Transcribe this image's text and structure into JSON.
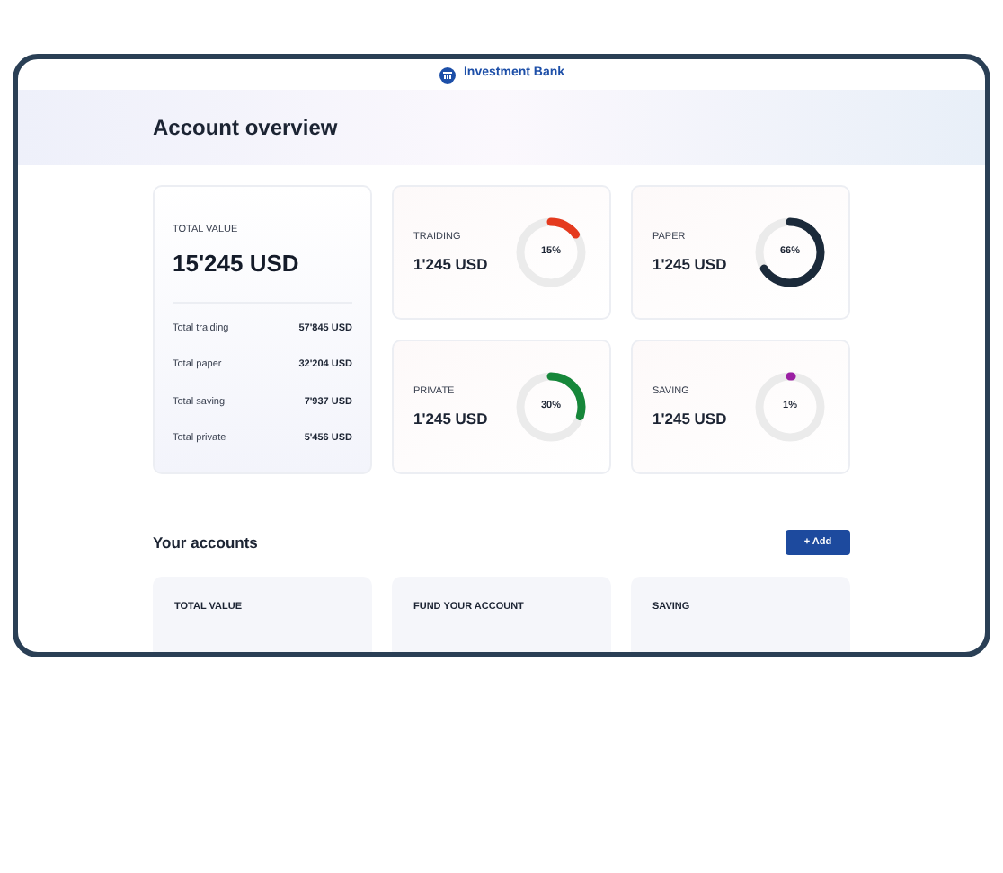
{
  "header": {
    "brand": "Investment Bank"
  },
  "page": {
    "title": "Account overview"
  },
  "summary": {
    "label": "TOTAL VALUE",
    "value": "15'245 USD",
    "rows": [
      {
        "label": "Total traiding",
        "value": "57'845 USD"
      },
      {
        "label": "Total paper",
        "value": "32'204 USD"
      },
      {
        "label": "Total saving",
        "value": "7'937 USD"
      },
      {
        "label": "Total private",
        "value": "5'456 USD"
      }
    ]
  },
  "portfolios": [
    {
      "label": "TRAIDING",
      "value": "1'245 USD",
      "percent": "15%",
      "level": 0.15,
      "color": "#e53a1e"
    },
    {
      "label": "PAPER",
      "value": "1'245 USD",
      "percent": "66%",
      "level": 0.66,
      "color": "#1b2a3a"
    },
    {
      "label": "PRIVATE",
      "value": "1'245 USD",
      "percent": "30%",
      "level": 0.3,
      "color": "#16873a"
    },
    {
      "label": "SAVING",
      "value": "1'245 USD",
      "percent": "1%",
      "level": 0.01,
      "color": "#9b1fa3"
    }
  ],
  "accounts": {
    "title": "Your accounts",
    "add_button": "+ Add",
    "cards": [
      {
        "label": "TOTAL VALUE"
      },
      {
        "label": "FUND YOUR ACCOUNT"
      },
      {
        "label": "SAVING"
      }
    ]
  }
}
